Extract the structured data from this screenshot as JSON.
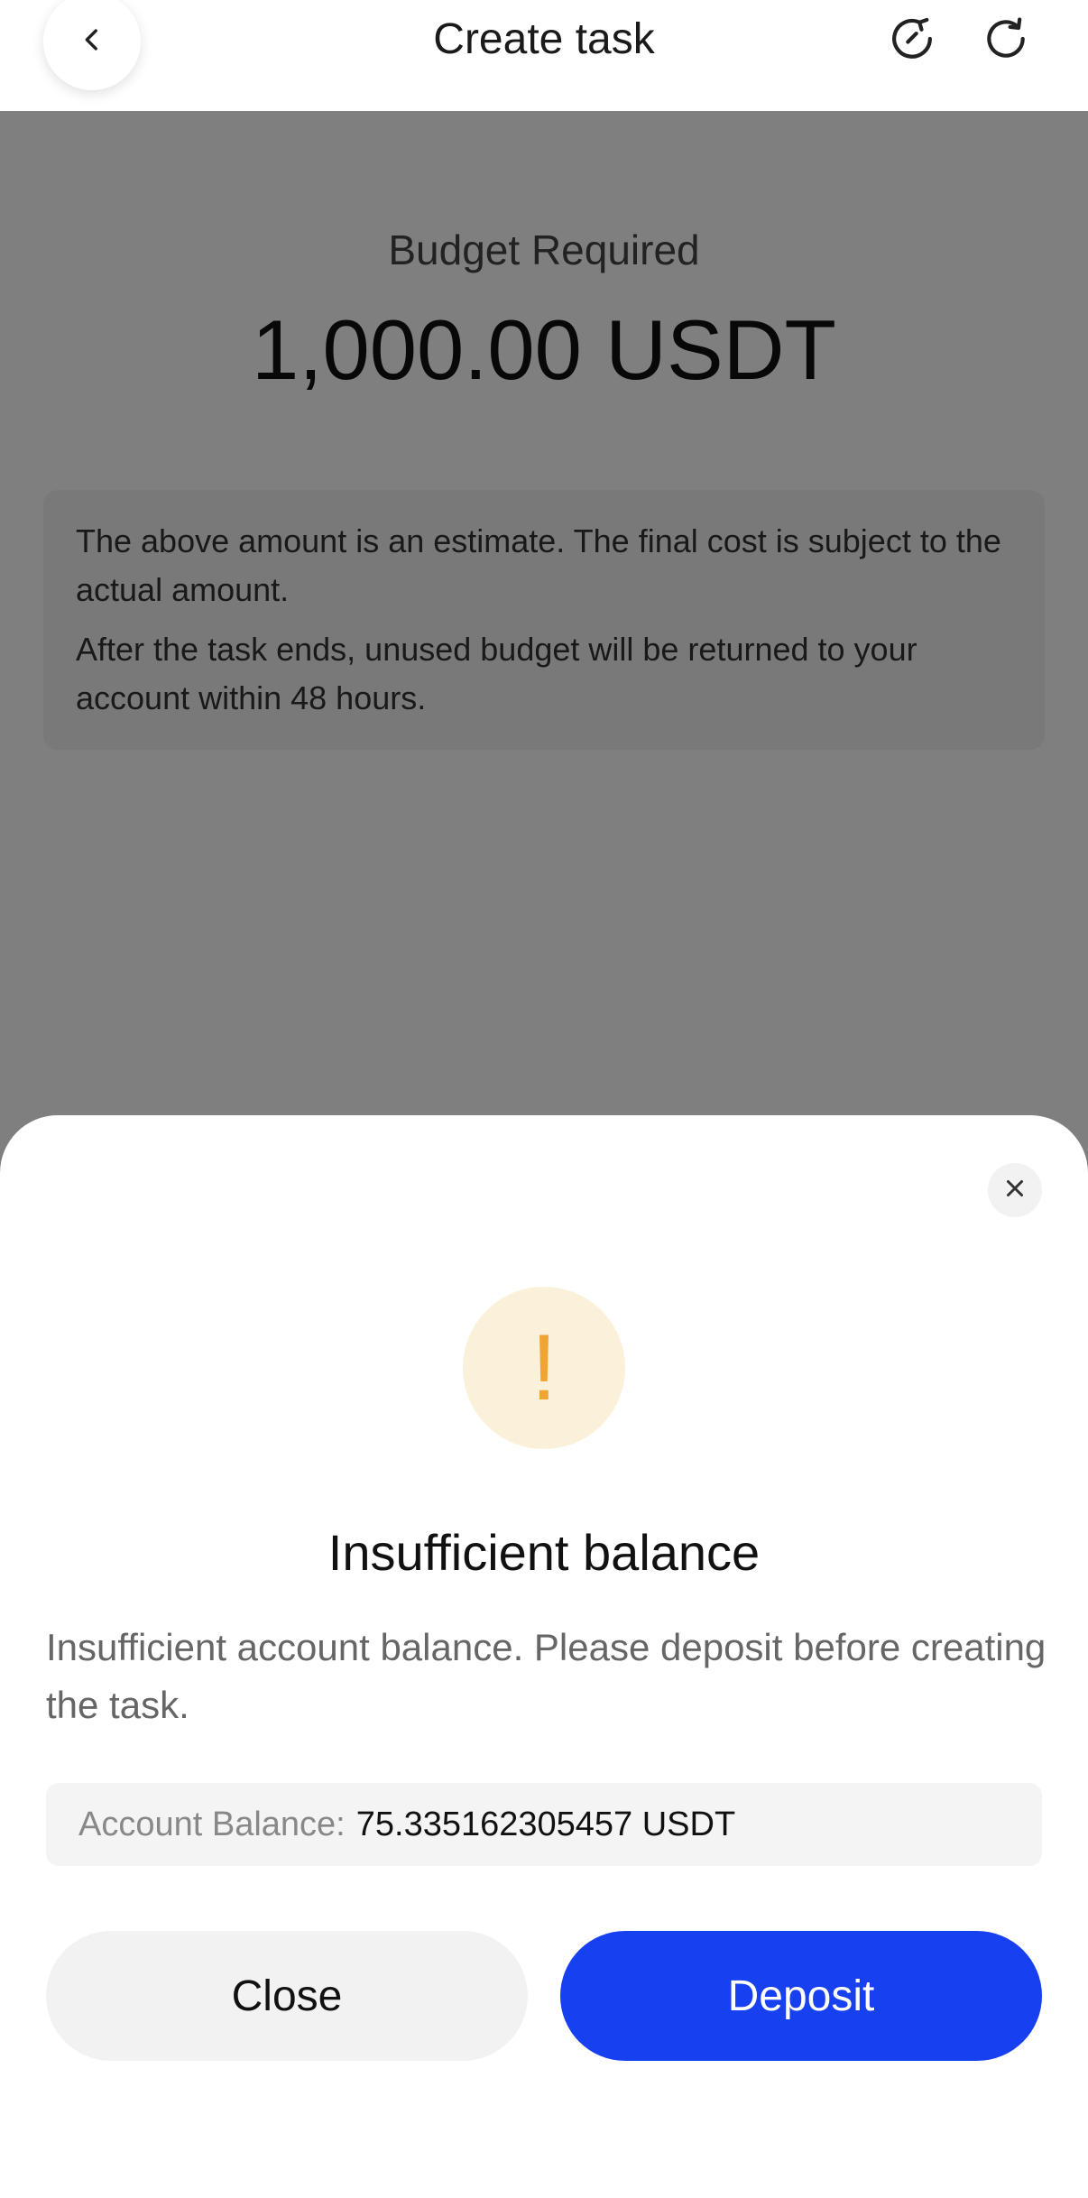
{
  "header": {
    "title": "Create task",
    "back_icon": "chevron-left-icon",
    "history_icon": "history-icon",
    "refresh_icon": "refresh-icon"
  },
  "budget": {
    "label": "Budget Required",
    "amount": "1,000.00 USDT"
  },
  "notes": [
    "The above amount is an estimate. The final cost is subject to the actual amount.",
    "After the task ends, unused budget will be returned to your account within 48 hours."
  ],
  "dialog": {
    "close_icon": "close-icon",
    "warning_icon": "exclamation-icon",
    "warning_symbol": "!",
    "title": "Insufficient balance",
    "message": "Insufficient account balance. Please deposit before creating the task.",
    "balance_label": "Account Balance:",
    "balance_value": "75.335162305457 USDT",
    "close_label": "Close",
    "deposit_label": "Deposit"
  },
  "colors": {
    "primary": "#1740f0",
    "warning": "#f0a533",
    "warning_bg": "#fbf0d9",
    "overlay": "rgba(0,0,0,0.5)"
  }
}
